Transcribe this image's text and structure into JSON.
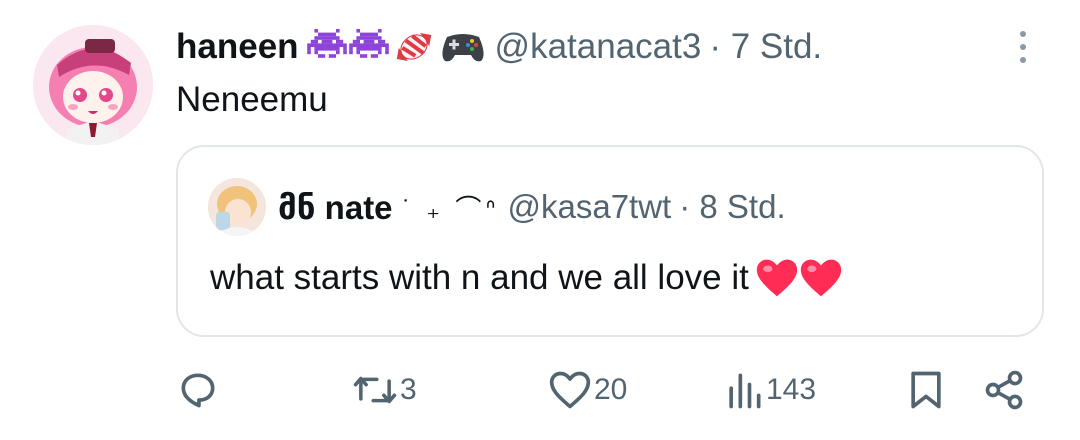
{
  "tweet": {
    "author_name": "haneen",
    "author_emojis": [
      "alien-monster-emoji",
      "alien-monster-emoji",
      "candy-emoji",
      "game-controller-emoji"
    ],
    "handle": "@katanacat3",
    "time": "· 7 Std.",
    "text": "Neneemu"
  },
  "quoted": {
    "author_name": "მნ nate",
    "author_decor": "˙ ₊ ⌒ᐢ",
    "handle": "@kasa7twt",
    "time": "· 8 Std.",
    "text": "what starts with n and we all love it",
    "emojis": [
      "heart-emoji",
      "heart-emoji"
    ]
  },
  "actions": {
    "reply_count": "",
    "retweet_count": "3",
    "like_count": "20",
    "views_count": "143"
  },
  "colors": {
    "text": "#0f1419",
    "secondary": "#536471",
    "border": "#e1e6ea",
    "heart": "#f91880"
  }
}
